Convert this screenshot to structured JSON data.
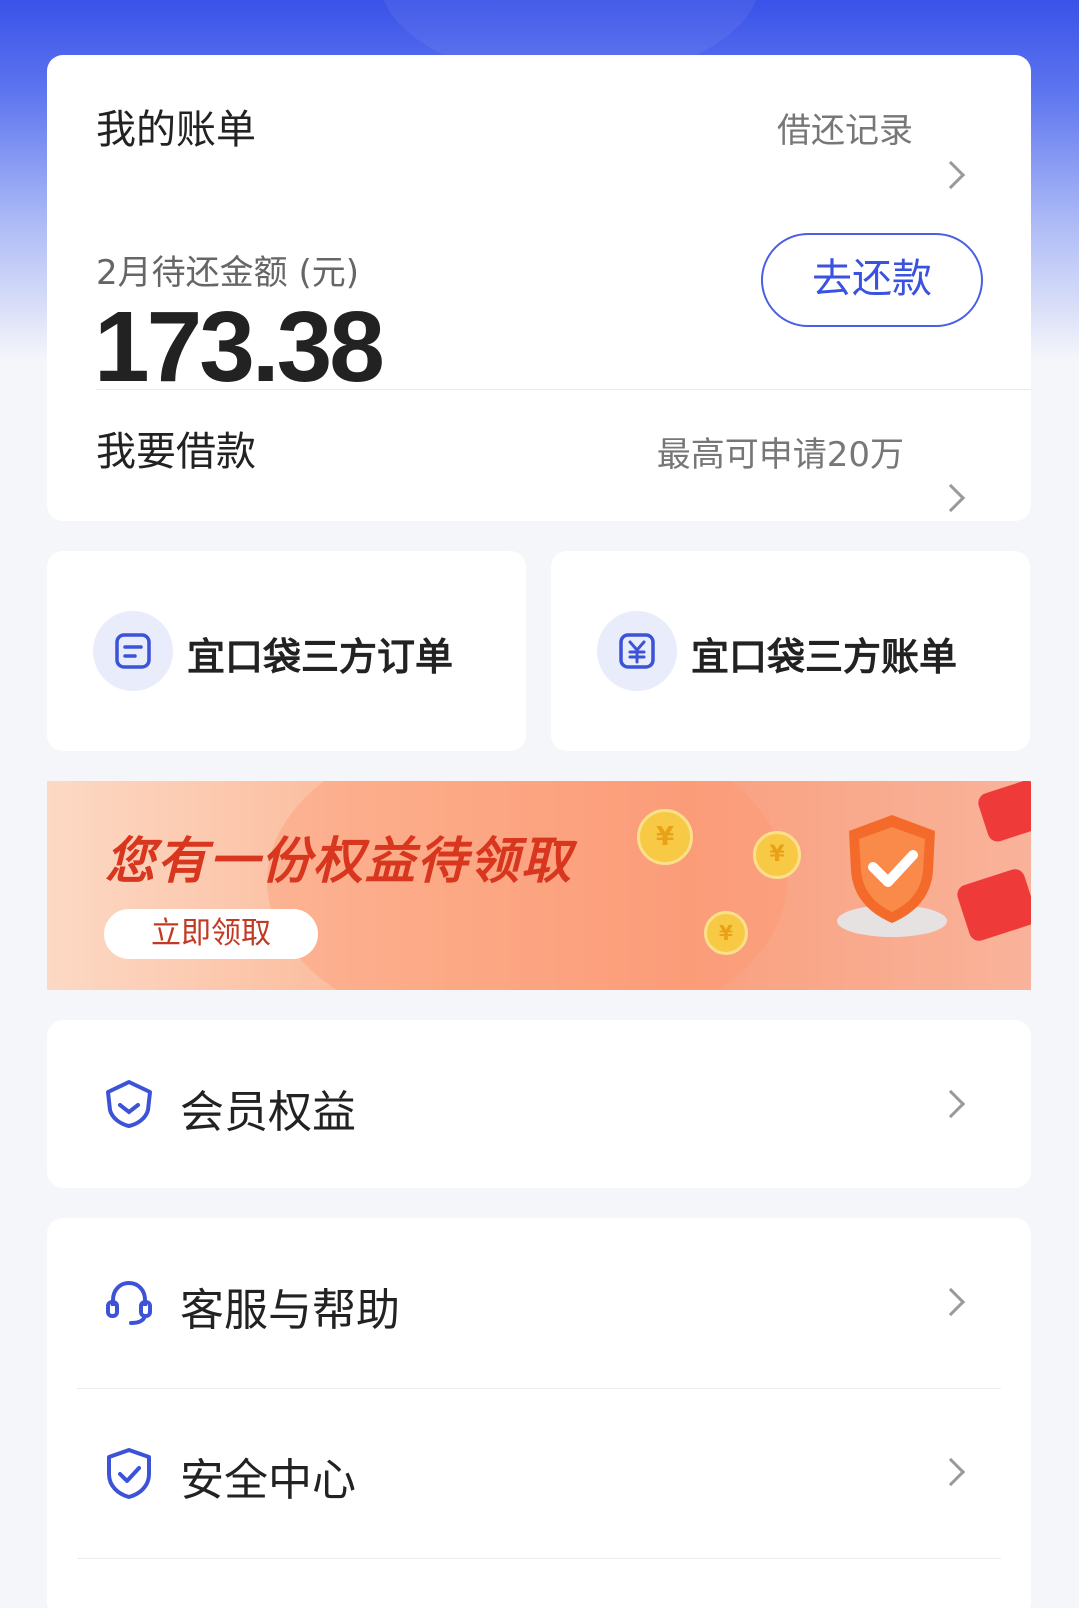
{
  "bill": {
    "title": "我的账单",
    "record_link": "借还记录",
    "subtitle": "2月待还金额 (元)",
    "amount": "173.38",
    "repay_button": "去还款"
  },
  "loan": {
    "title": "我要借款",
    "limit_text": "最高可申请20万"
  },
  "quick_links": [
    {
      "label": "宜口袋三方订单",
      "icon": "order-doc-icon"
    },
    {
      "label": "宜口袋三方账单",
      "icon": "yuan-bill-icon"
    }
  ],
  "banner": {
    "title": "您有一份权益待领取",
    "button": "立即领取"
  },
  "menu": {
    "member": {
      "label": "会员权益",
      "icon": "member-shield-icon"
    },
    "service": {
      "label": "客服与帮助",
      "icon": "headset-icon"
    },
    "security": {
      "label": "安全中心",
      "icon": "security-shield-icon"
    }
  },
  "colors": {
    "brand_blue": "#3a52e0",
    "banner_red": "#d8361e",
    "icon_blue": "#3c53d8"
  }
}
